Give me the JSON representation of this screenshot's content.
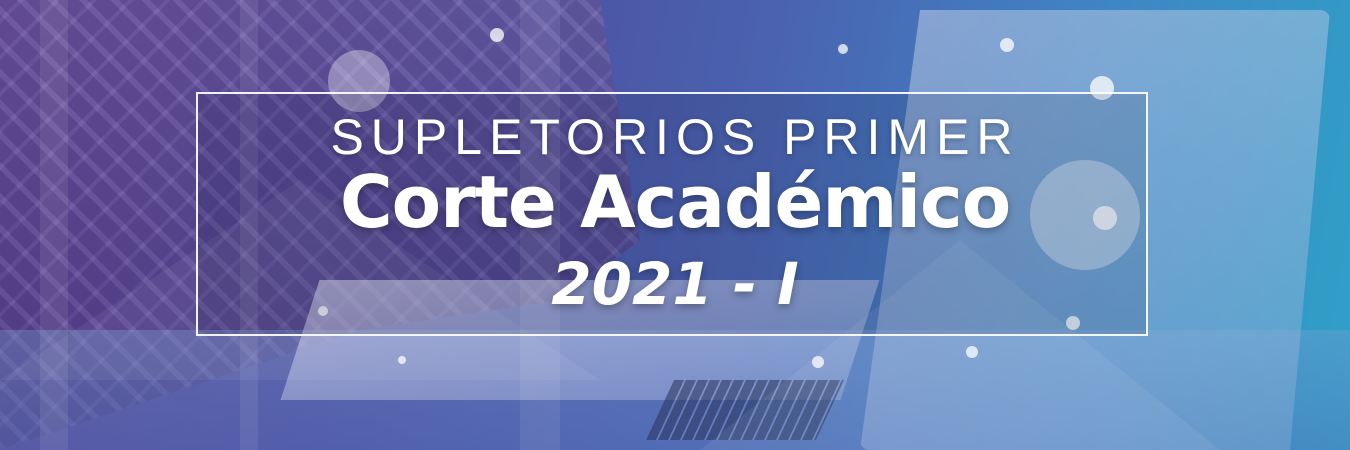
{
  "banner": {
    "line1": "SUPLETORIOS PRIMER",
    "line2": "Corte Académico",
    "line3": "2021 - I"
  },
  "colors": {
    "gradient_left": "#5a3f8f",
    "gradient_mid": "#4a63b0",
    "gradient_right": "#2fa0c8",
    "text": "#ffffff",
    "frame": "#ffffff"
  }
}
